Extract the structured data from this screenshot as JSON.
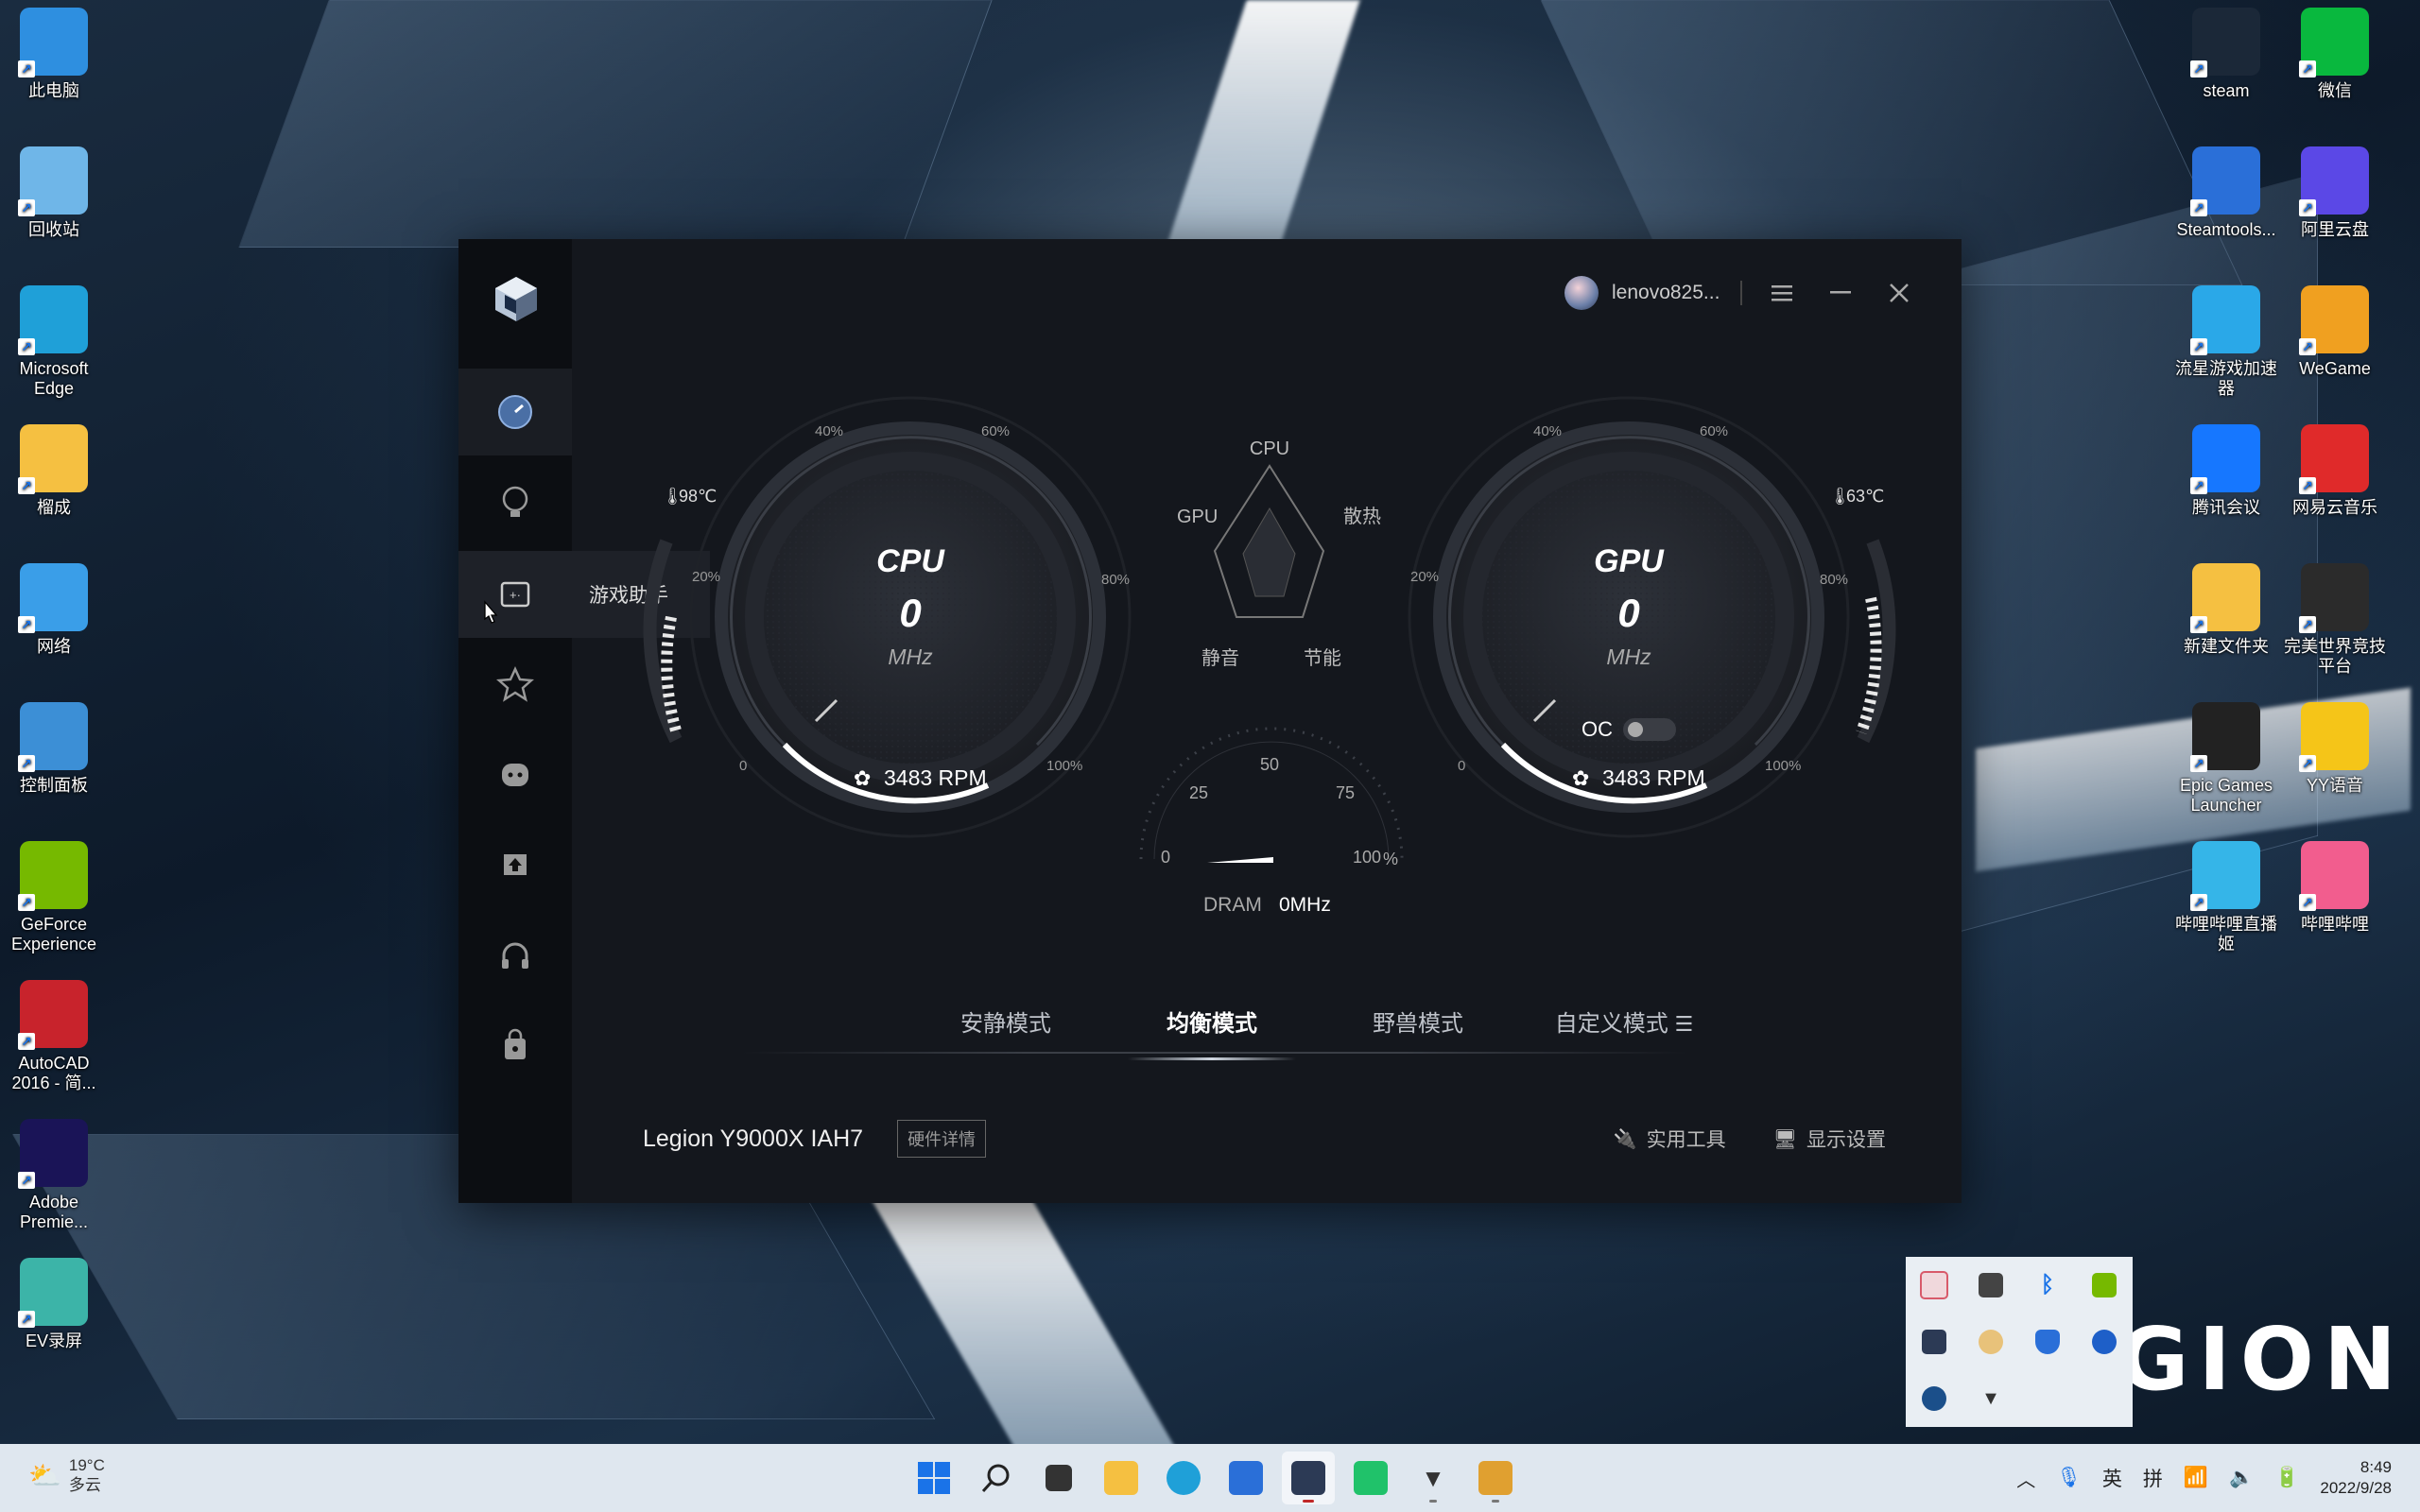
{
  "desktop_left": [
    {
      "label": "此电脑",
      "icon": "monitor-icon",
      "color": "#2e8fe0"
    },
    {
      "label": "回收站",
      "icon": "recycle-bin-icon",
      "color": "#6fb6e8"
    },
    {
      "label": "Microsoft Edge",
      "icon": "edge-icon",
      "color": "#1fa0d8"
    },
    {
      "label": "榴成",
      "icon": "user-folder-icon",
      "color": "#f5c041"
    },
    {
      "label": "网络",
      "icon": "network-icon",
      "color": "#3a9ee8"
    },
    {
      "label": "控制面板",
      "icon": "control-panel-icon",
      "color": "#3c8fd6"
    },
    {
      "label": "GeForce Experience",
      "icon": "nvidia-icon",
      "color": "#76b900"
    },
    {
      "label": "AutoCAD 2016 - 简...",
      "icon": "autocad-icon",
      "color": "#c8232c"
    },
    {
      "label": "Adobe Premie...",
      "icon": "premiere-icon",
      "color": "#1a1457"
    },
    {
      "label": "EV录屏",
      "icon": "ev-recorder-icon",
      "color": "#3cb4a8"
    }
  ],
  "desktop_right": [
    {
      "label": "steam",
      "icon": "steam-icon",
      "color": "#1b2838"
    },
    {
      "label": "微信",
      "icon": "wechat-icon",
      "color": "#09b83e"
    },
    {
      "label": "Steamtools...",
      "icon": "steamtools-icon",
      "color": "#2a6fd8"
    },
    {
      "label": "阿里云盘",
      "icon": "aliyun-drive-icon",
      "color": "#5b48e6"
    },
    {
      "label": "流星游戏加速器",
      "icon": "liuxing-accelerator-icon",
      "color": "#2aa8e8"
    },
    {
      "label": "WeGame",
      "icon": "wegame-icon",
      "color": "#f0a020"
    },
    {
      "label": "腾讯会议",
      "icon": "tencent-meeting-icon",
      "color": "#1677ff"
    },
    {
      "label": "网易云音乐",
      "icon": "netease-music-icon",
      "color": "#e02a2a"
    },
    {
      "label": "新建文件夹",
      "icon": "folder-icon",
      "color": "#f5c041"
    },
    {
      "label": "完美世界竞技平台",
      "icon": "perfect-world-icon",
      "color": "#2b2b2b"
    },
    {
      "label": "Epic Games Launcher",
      "icon": "epic-games-icon",
      "color": "#222"
    },
    {
      "label": "YY语音",
      "icon": "yy-voice-icon",
      "color": "#f5c518"
    },
    {
      "label": "哔哩哔哩直播姬",
      "icon": "bili-live-icon",
      "color": "#35b5e8"
    },
    {
      "label": "哔哩哔哩",
      "icon": "bilibili-icon",
      "color": "#f25d8e"
    }
  ],
  "wallpaper_logo": "GION",
  "app": {
    "user": "lenovo825...",
    "tooltip": "游戏助手",
    "cpu": {
      "label": "CPU",
      "value": "0",
      "unit": "MHz",
      "temp": "98℃",
      "fan": "3483 RPM"
    },
    "gpu": {
      "label": "GPU",
      "value": "0",
      "unit": "MHz",
      "temp": "63℃",
      "fan": "3483 RPM",
      "oc_label": "OC"
    },
    "gauge_ticks": [
      "0",
      "20%",
      "40%",
      "60%",
      "80%",
      "100%"
    ],
    "radar": {
      "top": "CPU",
      "left": "GPU",
      "right": "散热",
      "bottom_left": "静音",
      "bottom_right": "节能"
    },
    "dram": {
      "label": "DRAM",
      "value": "0MHz",
      "ticks": [
        "0",
        "25",
        "50",
        "75",
        "100"
      ],
      "unit": "%"
    },
    "modes": [
      "安静模式",
      "均衡模式",
      "野兽模式",
      "自定义模式"
    ],
    "active_mode": "均衡模式",
    "model": "Legion Y9000X IAH7",
    "hw_details": "硬件详情",
    "tools": "实用工具",
    "display_settings": "显示设置"
  },
  "taskbar": {
    "weather_temp": "19°C",
    "weather_text": "多云",
    "ime_lang": "英",
    "ime_mode": "拼",
    "time": "8:49",
    "date": "2022/9/28"
  }
}
